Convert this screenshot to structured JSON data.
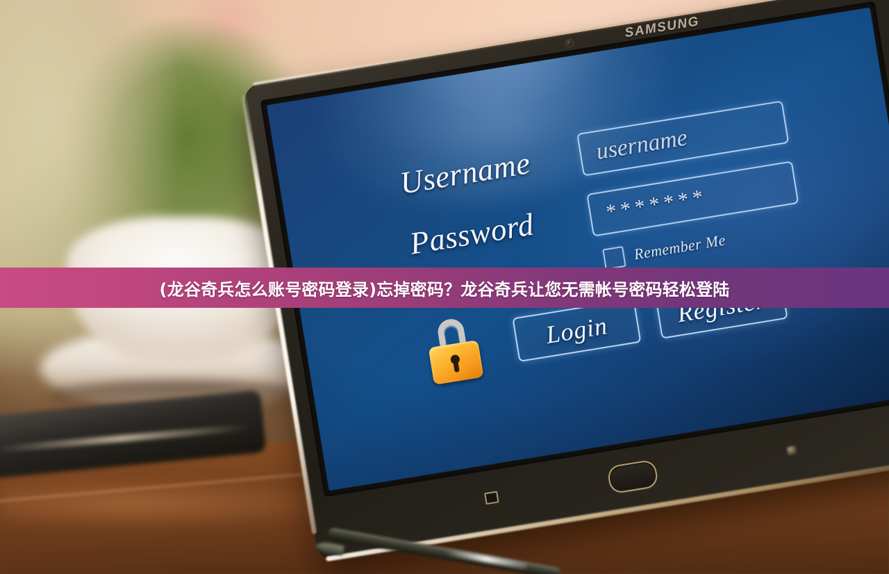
{
  "caption": {
    "text": "(龙谷奇兵怎么账号密码登录)忘掉密码？龙谷奇兵让您无需帐号密码轻松登陆",
    "gradient_from": "#c84b83",
    "gradient_mid": "#8e3a73",
    "gradient_to": "#6a3580"
  },
  "device": {
    "brand": "SAMSUNG",
    "bezel_color": "#211e18",
    "rail_color": "#fffaee"
  },
  "screen": {
    "background_color": "#14508c",
    "accent_color": "#c4dfff",
    "login_form": {
      "username": {
        "label": "Username",
        "value": "",
        "placeholder": "username"
      },
      "password": {
        "label": "Password",
        "value": "*******",
        "placeholder": ""
      },
      "remember_me": {
        "label": "Remember Me",
        "checked": false
      },
      "buttons": {
        "login": "Login",
        "register": "Register"
      },
      "lock_icon": {
        "name": "padlock-icon",
        "body_color": "#f7991d",
        "shackle_color": "#c9c8c2"
      }
    }
  },
  "scene": {
    "objects": [
      "coffee-cup",
      "saucer",
      "smartphone",
      "stylus-pen",
      "wooden-table",
      "green-plant"
    ]
  }
}
